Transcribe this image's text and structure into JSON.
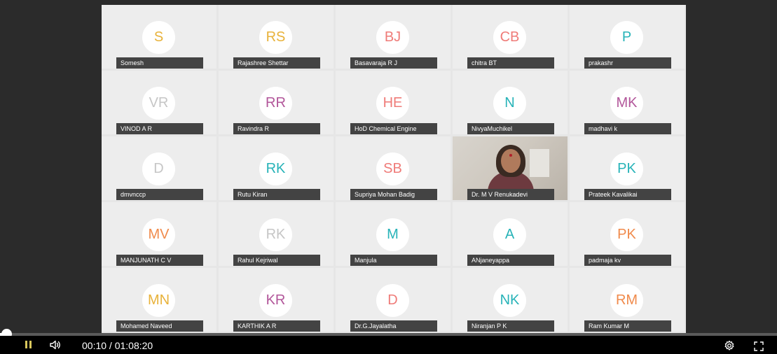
{
  "participants": [
    {
      "initials": "S",
      "name": "Somesh",
      "color": "#e8b23a"
    },
    {
      "initials": "RS",
      "name": "Rajashree Shettar",
      "color": "#e8b23a"
    },
    {
      "initials": "BJ",
      "name": "Basavaraja R J",
      "color": "#ef7b78"
    },
    {
      "initials": "CB",
      "name": "chitra BT",
      "color": "#ef7b78"
    },
    {
      "initials": "P",
      "name": "prakashr",
      "color": "#27b3b8"
    },
    {
      "initials": "VR",
      "name": "VINOD A R",
      "color": "#c6c6c6"
    },
    {
      "initials": "RR",
      "name": "Ravindra R",
      "color": "#b2569a"
    },
    {
      "initials": "HE",
      "name": "HoD Chemical Engine",
      "color": "#ef7b78"
    },
    {
      "initials": "N",
      "name": "NivyaMuchikel",
      "color": "#27b3b8"
    },
    {
      "initials": "MK",
      "name": "madhavi k",
      "color": "#b2569a"
    },
    {
      "initials": "D",
      "name": "dmvnccp",
      "color": "#c6c6c6"
    },
    {
      "initials": "RK",
      "name": "Rutu Kiran",
      "color": "#27b3b8"
    },
    {
      "initials": "SB",
      "name": "Supriya Mohan Badig",
      "color": "#ef7b78"
    },
    {
      "initials": "",
      "name": "Dr. M V Renukadevi",
      "color": "",
      "video": true
    },
    {
      "initials": "PK",
      "name": "Prateek Kavalikai",
      "color": "#27b3b8"
    },
    {
      "initials": "MV",
      "name": "MANJUNATH C V",
      "color": "#f08a4b"
    },
    {
      "initials": "RK",
      "name": "Rahul Kejriwal",
      "color": "#c6c6c6"
    },
    {
      "initials": "M",
      "name": "Manjula",
      "color": "#27b3b8"
    },
    {
      "initials": "A",
      "name": "ANjaneyappa",
      "color": "#27b3b8"
    },
    {
      "initials": "PK",
      "name": "padmaja kv",
      "color": "#f08a4b"
    },
    {
      "initials": "MN",
      "name": "Mohamed Naveed",
      "color": "#e8b23a"
    },
    {
      "initials": "KR",
      "name": "KARTHIK A R",
      "color": "#b2569a"
    },
    {
      "initials": "D",
      "name": "Dr.G.Jayalatha",
      "color": "#ef7b78"
    },
    {
      "initials": "NK",
      "name": "Niranjan P K",
      "color": "#27b3b8"
    },
    {
      "initials": "RM",
      "name": "Ram Kumar M",
      "color": "#f08a4b"
    }
  ],
  "player": {
    "time": "00:10 / 01:08:20",
    "progress_fraction": 0.0024,
    "play_state": "playing",
    "icons": {
      "play_pause": "pause-icon",
      "volume": "volume-icon",
      "settings": "gear-icon",
      "fullscreen": "fullscreen-icon"
    },
    "colors": {
      "pause_accent": "#d9c75c",
      "control_bar": "#000000",
      "video_background": "#2b2b2b"
    }
  }
}
